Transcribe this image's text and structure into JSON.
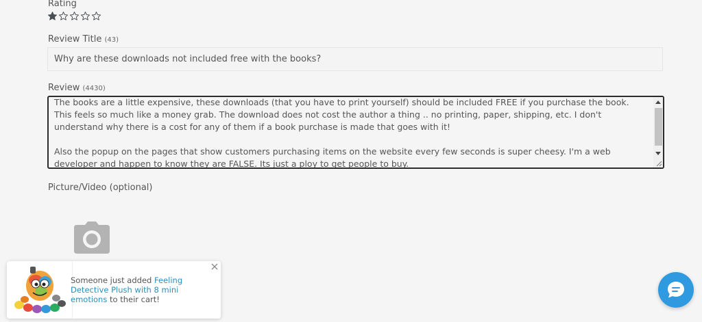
{
  "rating": {
    "label": "Rating",
    "value": 1,
    "max": 5,
    "star_color": "#4a4f55"
  },
  "review_title": {
    "label": "Review Title",
    "count": "(43)",
    "value": "Why are these downloads not included free with the books?"
  },
  "review": {
    "label": "Review",
    "count": "(4430)",
    "lines": [
      "The books are a little expensive, these downloads (that you have to print yourself) should be included FREE if you purchase the book.",
      "This feels so much like a money grab.  The download does not cost the author a thing .. no printing, paper, shipping, etc.  I don't",
      "understand why there is a cost for any of them if a book purchase is made that goes with it!",
      "",
      "Also the popup on the pages that show customers purchasing items on the website every few seconds is super cheesy. I'm a web",
      "developer and happen to know they are FALSE.  Its just a ploy to get people to buy."
    ]
  },
  "media": {
    "label": "Picture/Video (optional)",
    "icon": "camera-icon"
  },
  "toast": {
    "prefix": "Someone just added ",
    "product_line1": "Feeling",
    "product_line2": "Detective Plush with 8 mini",
    "product_line3": "emotions",
    "suffix": " to their cart!",
    "link_color": "#2a8fbd"
  },
  "chat": {
    "icon": "chat-bubble-icon",
    "color": "#2f9ae0"
  }
}
